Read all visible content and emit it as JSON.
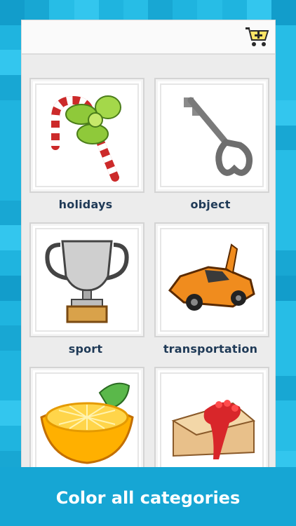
{
  "colors": {
    "accent": "#1fb4df",
    "label": "#1f3a57"
  },
  "header": {
    "cart_icon": "shopping-cart-add-icon"
  },
  "categories": [
    {
      "label": "holidays",
      "icon": "candy-cane-icon"
    },
    {
      "label": "object",
      "icon": "key-icon"
    },
    {
      "label": "sport",
      "icon": "trophy-icon"
    },
    {
      "label": "transportation",
      "icon": "sports-car-icon"
    },
    {
      "label": "",
      "icon": "orange-icon"
    },
    {
      "label": "",
      "icon": "cake-slice-icon"
    }
  ],
  "caption": {
    "text": "Color all categories"
  }
}
